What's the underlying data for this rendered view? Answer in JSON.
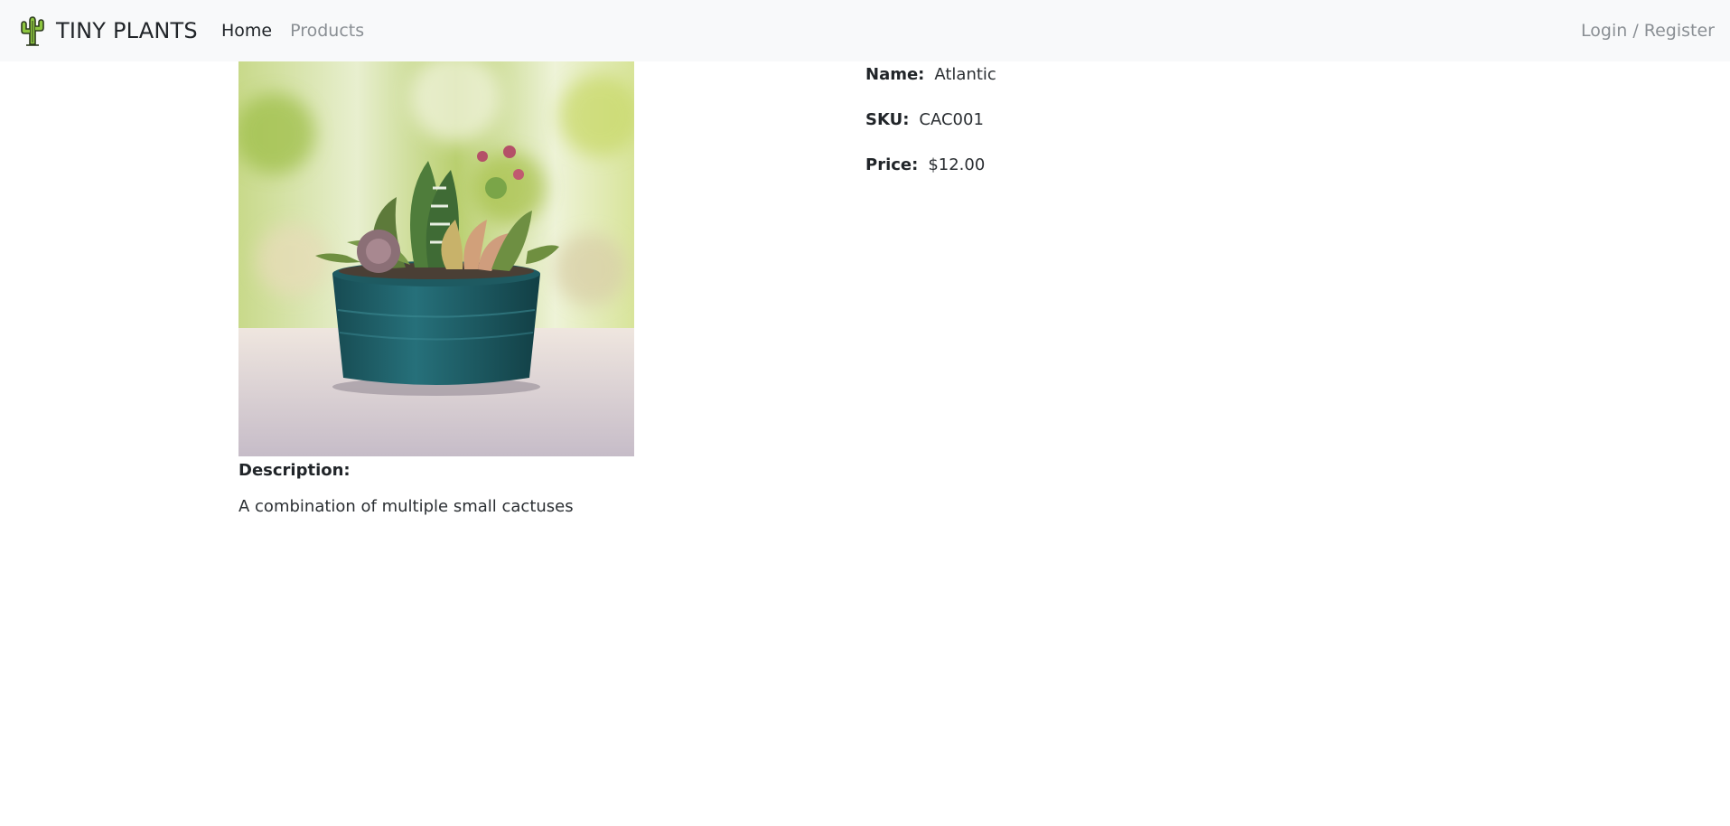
{
  "navbar": {
    "brand_icon": "cactus-icon",
    "brand_text": "TINY PLANTS",
    "links": [
      {
        "label": "Home",
        "active": true
      },
      {
        "label": "Products",
        "active": false
      }
    ],
    "auth_link": "Login / Register",
    "background": "#f8f9fa"
  },
  "product": {
    "image_subject": "potted-succulents-image",
    "fields": [
      {
        "label": "Name:",
        "value": "Atlantic"
      },
      {
        "label": "SKU:",
        "value": "CAC001"
      },
      {
        "label": "Price:",
        "value": "$12.00"
      }
    ],
    "description_label": "Description:",
    "description": "A combination of multiple small cactuses"
  },
  "colors": {
    "text": "#212529",
    "muted": "#8a8f94",
    "pot": "#1f5e64"
  }
}
